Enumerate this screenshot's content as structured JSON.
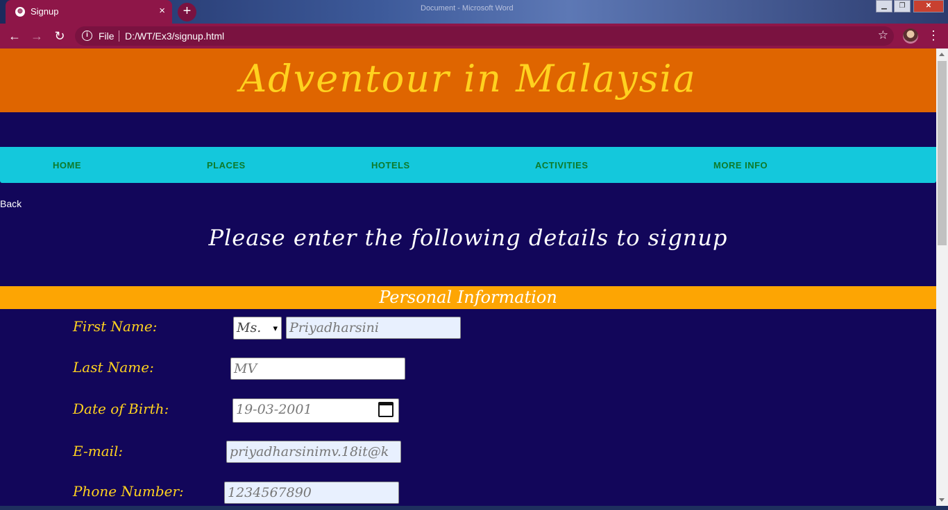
{
  "browser": {
    "tab_title": "Signup",
    "tab_close": "×",
    "new_tab": "+",
    "window_title": "Document - Microsoft Word",
    "address_scheme": "File",
    "url": "D:/WT/Ex3/signup.html"
  },
  "page": {
    "banner_title": "Adventour in Malaysia",
    "nav": [
      "HOME",
      "PLACES",
      "HOTELS",
      "ACTIVITIES",
      "MORE INFO"
    ],
    "back_link": "Back",
    "heading": "Please enter the following details to signup",
    "section_title": "Personal Information"
  },
  "form": {
    "first_name_label": "First Name:",
    "title_select": "Ms.",
    "first_name_value": "Priyadharsini",
    "last_name_label": "Last Name:",
    "last_name_value": "MV",
    "dob_label": "Date of Birth:",
    "dob_value": "19-03-2001",
    "email_label": "E-mail:",
    "email_value": "priyadharsinimv.18it@k",
    "phone_label": "Phone Number:",
    "phone_value": "1234567890"
  },
  "colors": {
    "background": "#12065a",
    "banner": "#df6500",
    "banner_text": "#ffd21f",
    "navbar": "#14c8dc",
    "nav_text": "#0d7a2a",
    "section": "#fda503",
    "browser_accent": "#8e1648"
  }
}
